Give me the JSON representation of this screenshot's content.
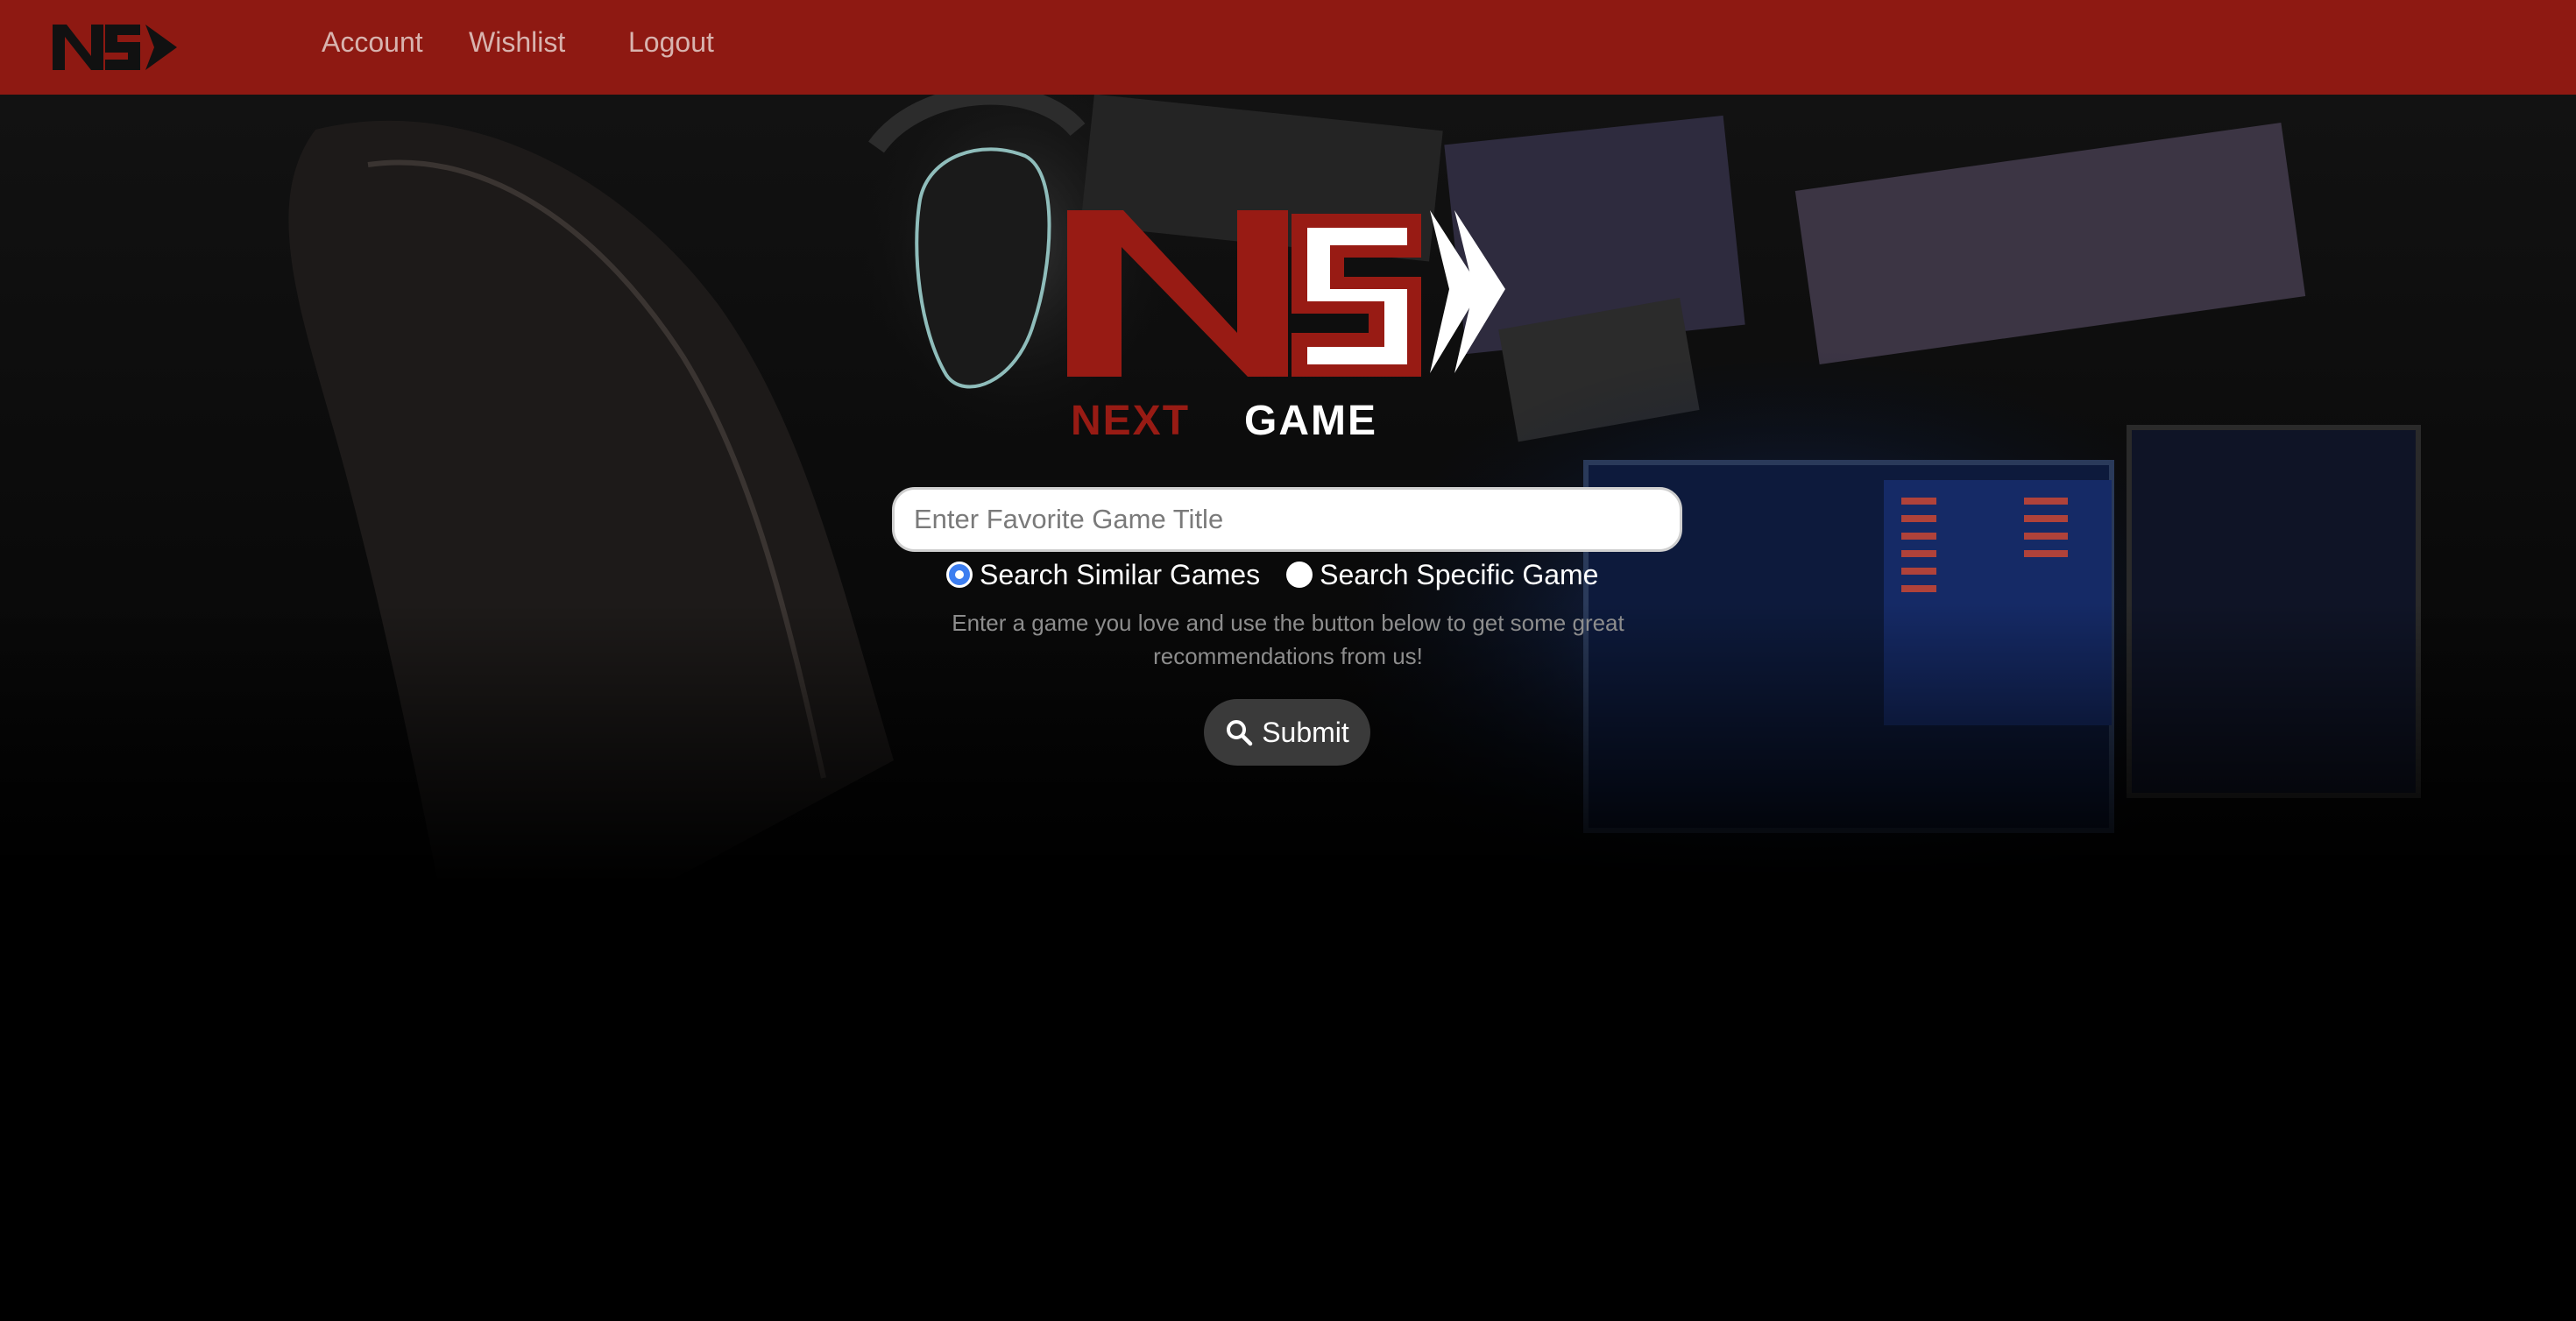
{
  "nav": {
    "logo": "NG",
    "links": [
      "Account",
      "Wishlist",
      "Logout"
    ]
  },
  "hero": {
    "logo_word_1": "NEXT",
    "logo_word_2": "GAME"
  },
  "search": {
    "placeholder": "Enter Favorite Game Title",
    "value": "",
    "options": [
      "Search Similar Games",
      "Search Specific Game"
    ],
    "selected_option": "Search Similar Games",
    "helper_text": "Enter a game you love and use the button below to get some great recommendations from us!",
    "submit_label": "Submit"
  },
  "colors": {
    "brand_red": "#8e1912",
    "radio_accent": "#3d7ef0",
    "button_bg": "#3a3a3a"
  }
}
